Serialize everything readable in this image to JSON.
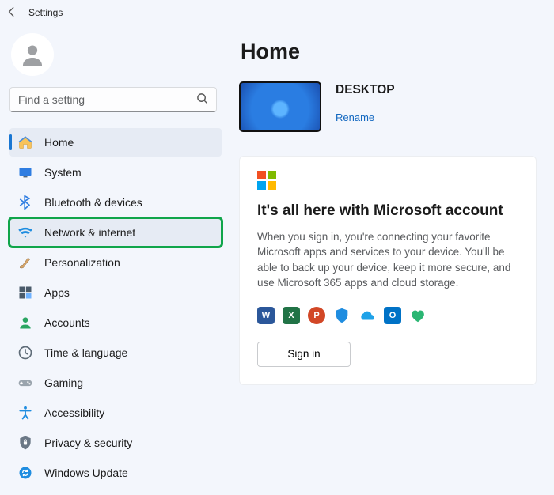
{
  "titlebar": {
    "title": "Settings"
  },
  "search": {
    "placeholder": "Find a setting"
  },
  "nav": {
    "items": [
      {
        "label": "Home"
      },
      {
        "label": "System"
      },
      {
        "label": "Bluetooth & devices"
      },
      {
        "label": "Network & internet"
      },
      {
        "label": "Personalization"
      },
      {
        "label": "Apps"
      },
      {
        "label": "Accounts"
      },
      {
        "label": "Time & language"
      },
      {
        "label": "Gaming"
      },
      {
        "label": "Accessibility"
      },
      {
        "label": "Privacy & security"
      },
      {
        "label": "Windows Update"
      }
    ],
    "selected_index": 0,
    "highlighted_index": 3
  },
  "main": {
    "heading": "Home",
    "device": {
      "name": "DESKTOP",
      "rename": "Rename"
    },
    "card": {
      "title": "It's all here with Microsoft account",
      "body": "When you sign in, you're connecting your favorite Microsoft apps and services to your device. You'll be able to back up your device, keep it more secure, and use Microsoft 365 apps and cloud storage.",
      "signin": "Sign in",
      "apps": [
        "word",
        "excel",
        "powerpoint",
        "defender",
        "onedrive",
        "outlook",
        "family"
      ]
    }
  }
}
